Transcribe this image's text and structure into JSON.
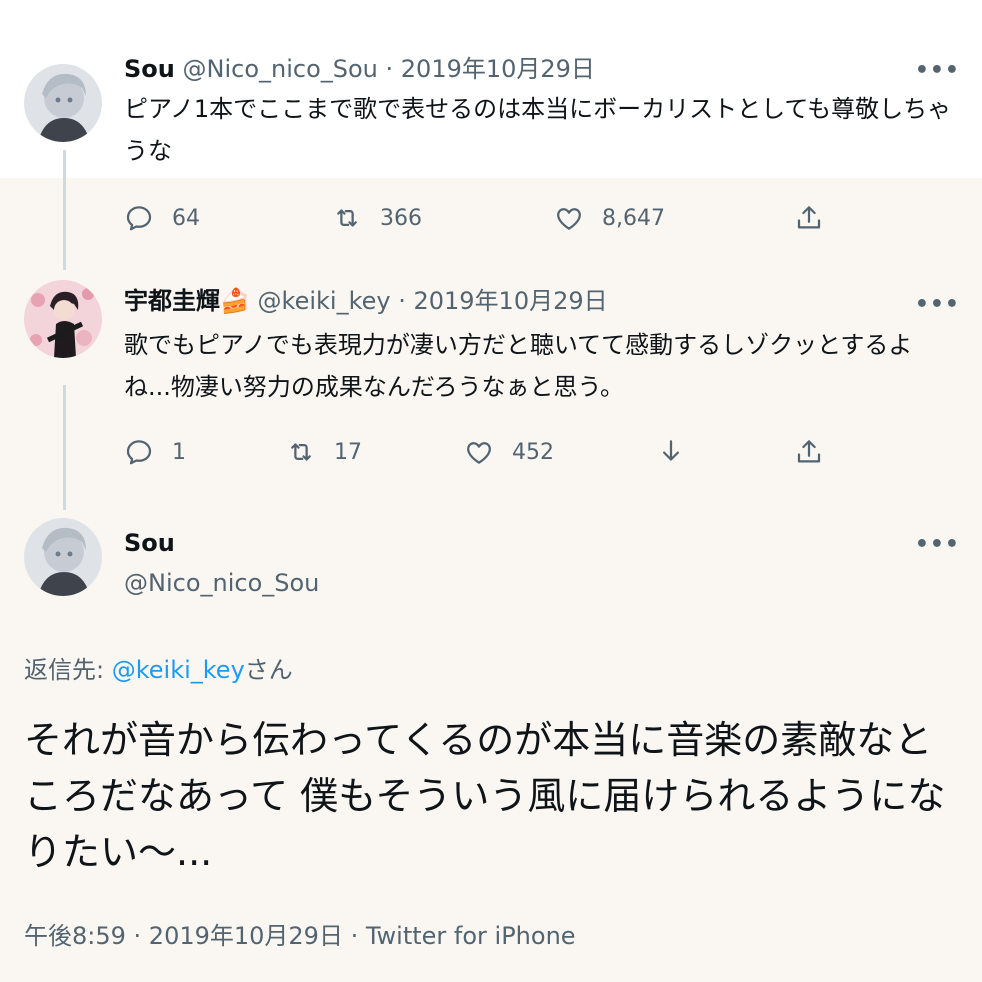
{
  "tweets": [
    {
      "name": "Sou",
      "handle": "@Nico_nico_Sou",
      "sep": " · ",
      "date": "2019年10月29日",
      "text": "ピアノ1本でここまで歌で表せるのは本当にボーカリストとしても尊敬しちゃうな",
      "more": "•••",
      "replies": "64",
      "retweets": "366",
      "likes": "8,647"
    },
    {
      "name": "宇都圭輝",
      "emoji": "🍰",
      "handle": "@keiki_key",
      "sep": " · ",
      "date": "2019年10月29日",
      "text": "歌でもピアノでも表現力が凄い方だと聴いてて感動するしゾクッとするよね...物凄い努力の成果なんだろうなぁと思う。",
      "more": "•••",
      "replies": "1",
      "retweets": "17",
      "likes": "452"
    }
  ],
  "main": {
    "name": "Sou",
    "handle": "@Nico_nico_Sou",
    "more": "•••",
    "reply_prefix": "返信先: ",
    "reply_handle": "@keiki_key",
    "reply_suffix": "さん",
    "text": "それが音から伝わってくるのが本当に音楽の素敵なところだなあって 僕もそういう風に届けられるようになりたい〜...",
    "time": "午後8:59",
    "sep1": " · ",
    "date": "2019年10月29日",
    "sep2": " · ",
    "source": "Twitter for iPhone"
  },
  "icons": [
    "reply-icon",
    "retweet-icon",
    "like-icon",
    "share-icon",
    "download-icon",
    "more-icon"
  ],
  "colors": {
    "accent": "#1d9bf0",
    "muted": "#536471",
    "background": "#faf7f2",
    "line": "#cfd9de"
  }
}
